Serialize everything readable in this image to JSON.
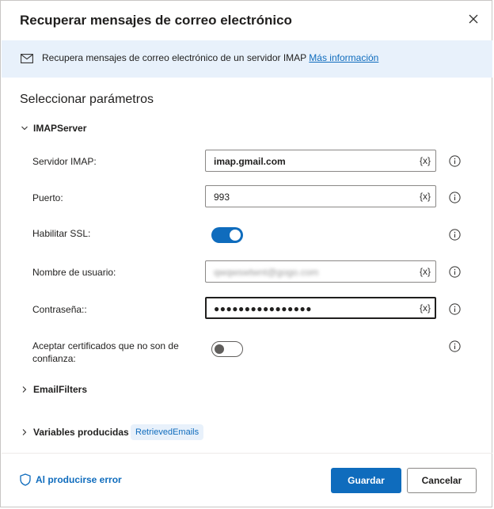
{
  "dialog": {
    "title": "Recuperar mensajes de correo electrónico",
    "close_icon": "close-icon"
  },
  "banner": {
    "icon": "mail-icon",
    "text": "Recupera mensajes de correo electrónico de un servidor IMAP ",
    "link": "Más información"
  },
  "section_title": "Seleccionar parámetros",
  "groups": {
    "imap_server": {
      "label": "IMAPServer",
      "expanded": true
    },
    "email_filters": {
      "label": "EmailFilters",
      "expanded": false
    },
    "variables": {
      "label": "Variables producidas",
      "expanded": false,
      "chip": "RetrievedEmails"
    }
  },
  "fields": {
    "server": {
      "label": "Servidor IMAP:",
      "value": "imap.gmail.com",
      "var_button": "{x}"
    },
    "port": {
      "label": "Puerto:",
      "value": "993",
      "var_button": "{x}"
    },
    "ssl": {
      "label": "Habilitar SSL:",
      "checked": true
    },
    "username": {
      "label": "Nombre de usuario:",
      "value": "qwqwswtwnt@gogo.com",
      "var_button": "{x}"
    },
    "password": {
      "label": "Contraseña::",
      "value": "●●●●●●●●●●●●●●●●",
      "var_button": "{x}"
    },
    "accept_certs": {
      "label": "Aceptar certificados que no son de confianza:",
      "checked": false
    }
  },
  "footer": {
    "error_link": "Al producirse error",
    "save_label": "Guardar",
    "cancel_label": "Cancelar"
  },
  "colors": {
    "accent": "#0f6cbd",
    "banner_bg": "#e8f1fb"
  }
}
